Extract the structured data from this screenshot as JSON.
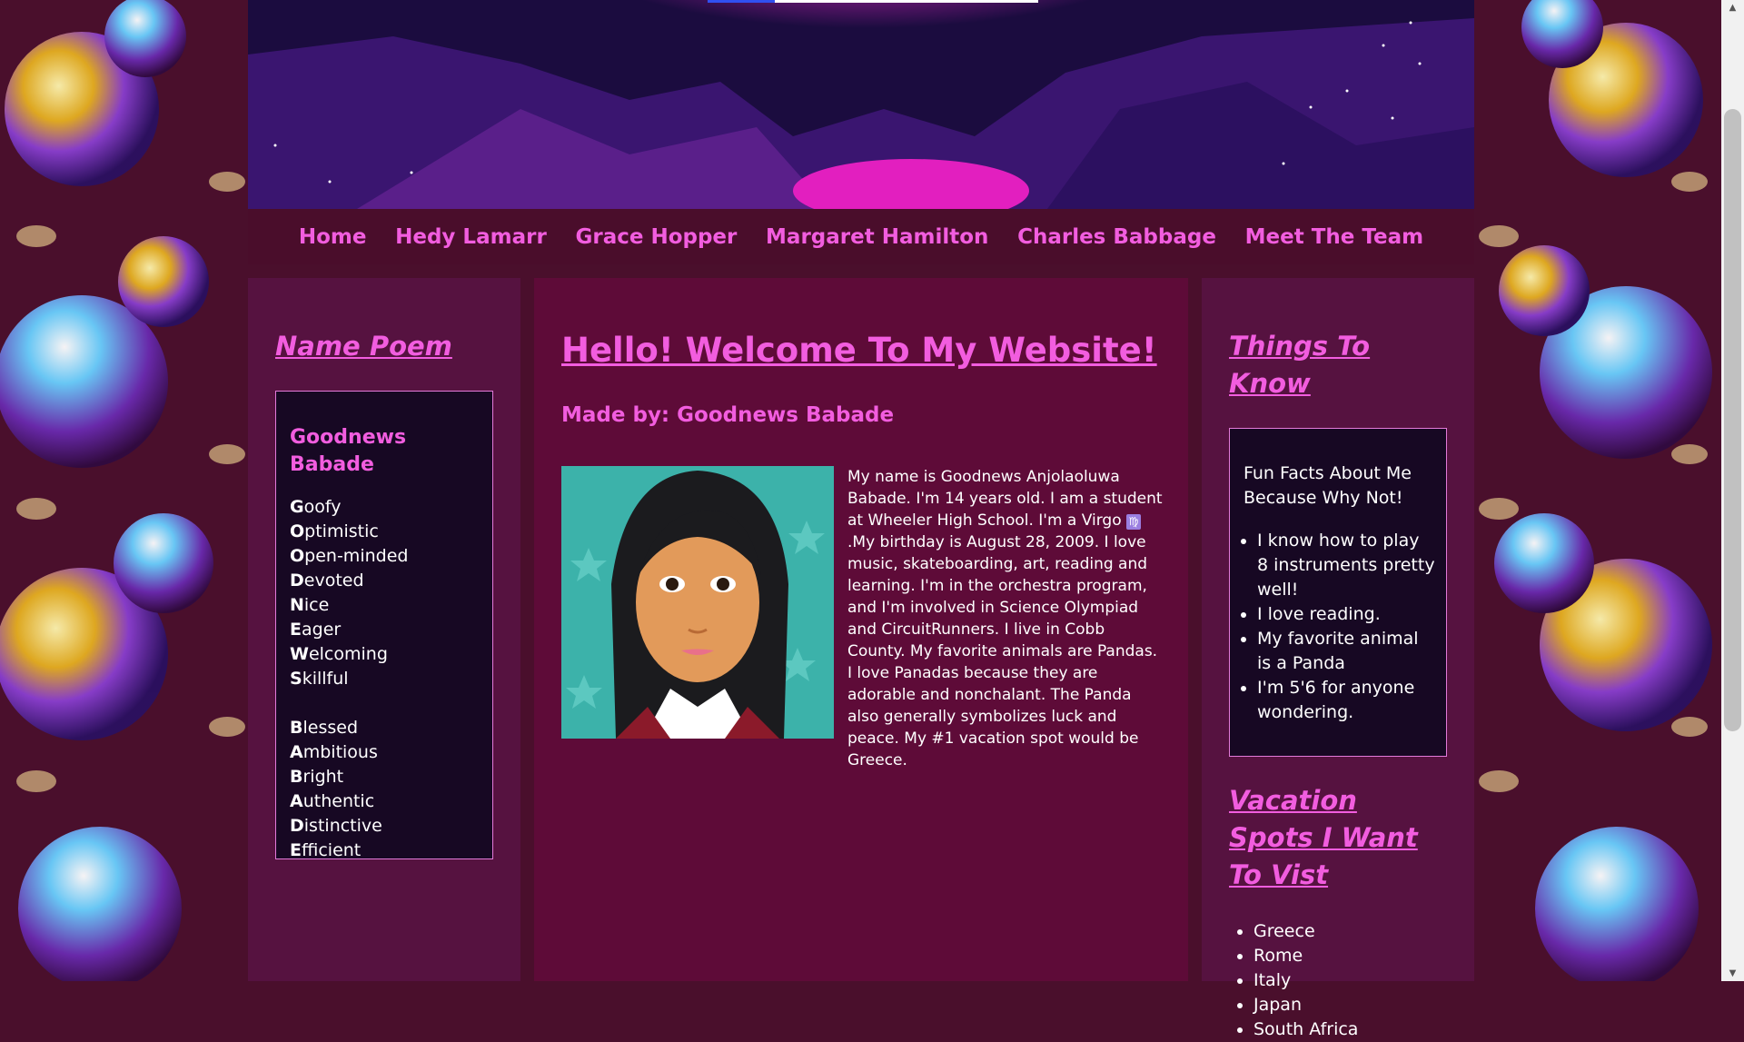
{
  "nav": {
    "items": [
      "Home",
      "Hedy Lamarr",
      "Grace Hopper",
      "Margaret Hamilton",
      "Charles Babbage",
      "Meet The Team"
    ]
  },
  "left": {
    "heading": "Name Poem",
    "poem_title": "Goodnews Babade",
    "lines1": [
      {
        "initial": "G",
        "rest": "oofy"
      },
      {
        "initial": "O",
        "rest": "ptimistic"
      },
      {
        "initial": "O",
        "rest": "pen-minded"
      },
      {
        "initial": "D",
        "rest": "evoted"
      },
      {
        "initial": "N",
        "rest": "ice"
      },
      {
        "initial": "E",
        "rest": "ager"
      },
      {
        "initial": "W",
        "rest": "elcoming"
      },
      {
        "initial": "S",
        "rest": "killful"
      }
    ],
    "lines2": [
      {
        "initial": "B",
        "rest": "lessed"
      },
      {
        "initial": "A",
        "rest": "mbitious"
      },
      {
        "initial": "B",
        "rest": "right"
      },
      {
        "initial": "A",
        "rest": "uthentic"
      },
      {
        "initial": "D",
        "rest": "istinctive"
      },
      {
        "initial": "E",
        "rest": "fficient"
      }
    ]
  },
  "main": {
    "title": "Hello! Welcome To My Website!",
    "byline": "Made by: Goodnews Babade",
    "bio_part1": "My name is Goodnews Anjolaoluwa Babade. I'm 14 years old. I am a student at Wheeler High School. I'm a Virgo ",
    "zodiac_symbol": "♍",
    "bio_part2": " .My birthday is August 28, 2009. I love music, skateboarding, art, reading and learning. I'm in the orchestra program, and I'm involved in Science Olympiad and CircuitRunners. I live in Cobb County. My favorite animals are Pandas. I love Panadas because they are adorable and nonchalant. The Panda also generally symbolizes luck and peace. My #1 vacation spot would be Greece."
  },
  "right": {
    "heading": "Things To Know",
    "facts_intro": "Fun Facts About Me Because Why Not!",
    "facts": [
      "I know how to play 8 instruments pretty well!",
      "I love reading.",
      "My favorite animal is a Panda",
      "I'm 5'6 for anyone wondering."
    ],
    "vacation_heading": "Vacation Spots I Want To Vist",
    "vacations": [
      "Greece",
      "Rome",
      "Italy",
      "Japan",
      "South Africa"
    ]
  },
  "colors": {
    "accent": "#f25ddf",
    "page_bg": "#4a0f2c",
    "column_bg": "#561240",
    "main_bg": "#5e0b38",
    "box_bg": "#170823"
  }
}
